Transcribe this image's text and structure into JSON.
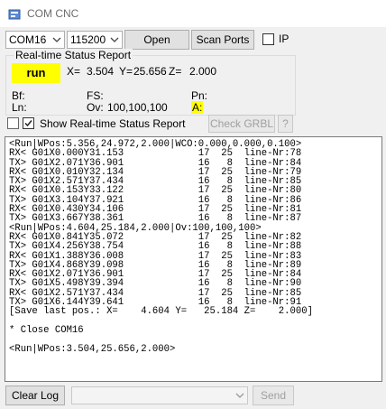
{
  "window": {
    "title": "COM CNC"
  },
  "toolbar": {
    "port_value": "COM16",
    "baud_value": "115200",
    "open_label": "Open",
    "scan_label": "Scan Ports",
    "ip_label": "IP"
  },
  "status": {
    "group_label": "Real-time Status Report",
    "state": "run",
    "x_label": "X=",
    "x_value": "3.504",
    "y_label": "Y=",
    "y_value": "25.656",
    "z_label": "Z=",
    "z_value": "2.000",
    "bf_label": "Bf:",
    "fs_label": "FS:",
    "pn_label": "Pn:",
    "ln_label": "Ln:",
    "ov_label": "Ov:",
    "ov_value": "100,100,100",
    "a_label": "A:",
    "show_report_label": "Show Real-time Status Report",
    "check_grbl_label": "Check GRBL",
    "help_label": "?"
  },
  "console": {
    "lines": [
      "<Run|WPos:5.356,24.972,2.000|WCO:0.000,0.000,0.100>",
      "RX< G01X0.000Y31.153             17  25  line-Nr:78",
      "TX> G01X2.071Y36.901             16   8  line-Nr:84",
      "RX< G01X0.010Y32.134             17  25  line-Nr:79",
      "TX> G01X2.571Y37.434             16   8  line-Nr:85",
      "RX< G01X0.153Y33.122             17  25  line-Nr:80",
      "TX> G01X3.104Y37.921             16   8  line-Nr:86",
      "RX< G01X0.430Y34.106             17  25  line-Nr:81",
      "TX> G01X3.667Y38.361             16   8  line-Nr:87",
      "<Run|WPos:4.604,25.184,2.000|Ov:100,100,100>",
      "RX< G01X0.841Y35.072             17  25  line-Nr:82",
      "TX> G01X4.256Y38.754             16   8  line-Nr:88",
      "RX< G01X1.388Y36.008             17  25  line-Nr:83",
      "TX> G01X4.868Y39.098             16   8  line-Nr:89",
      "RX< G01X2.071Y36.901             17  25  line-Nr:84",
      "TX> G01X5.498Y39.394             16   8  line-Nr:90",
      "RX< G01X2.571Y37.434             17  25  line-Nr:85",
      "TX> G01X6.144Y39.641             16   8  line-Nr:91",
      "[Save last pos.: X=    4.604 Y=   25.184 Z=    2.000]",
      "",
      "* Close COM16",
      "",
      "<Run|WPos:3.504,25.656,2.000>"
    ]
  },
  "bottom": {
    "clear_log_label": "Clear Log",
    "command_value": "",
    "send_label": "Send"
  }
}
